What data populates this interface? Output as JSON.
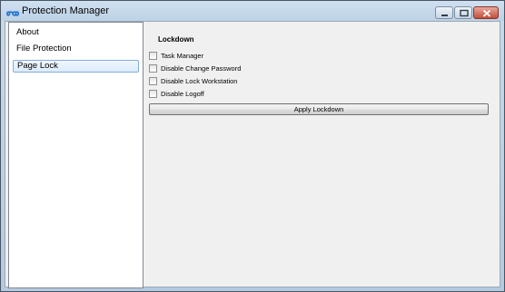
{
  "window": {
    "title": "Protection Manager",
    "icon": "infinity-logo-icon",
    "controls": [
      "minimize-icon",
      "maximize-icon",
      "close-icon"
    ]
  },
  "sidebar": {
    "items": [
      {
        "label": "About",
        "selected": false
      },
      {
        "label": "File Protection",
        "selected": false
      },
      {
        "label": "Page Lock",
        "selected": true
      }
    ]
  },
  "main": {
    "heading": "Lockdown",
    "options": [
      {
        "label": "Task Manager",
        "checked": false
      },
      {
        "label": "Disable Change Password",
        "checked": false
      },
      {
        "label": "Disable Lock Workstation",
        "checked": false
      },
      {
        "label": "Disable Logoff",
        "checked": false
      }
    ],
    "apply_label": "Apply Lockdown"
  },
  "colors": {
    "selection_border": "#84acdd",
    "close_button": "#c24e3c",
    "title_bar": "#bdd2e6"
  }
}
